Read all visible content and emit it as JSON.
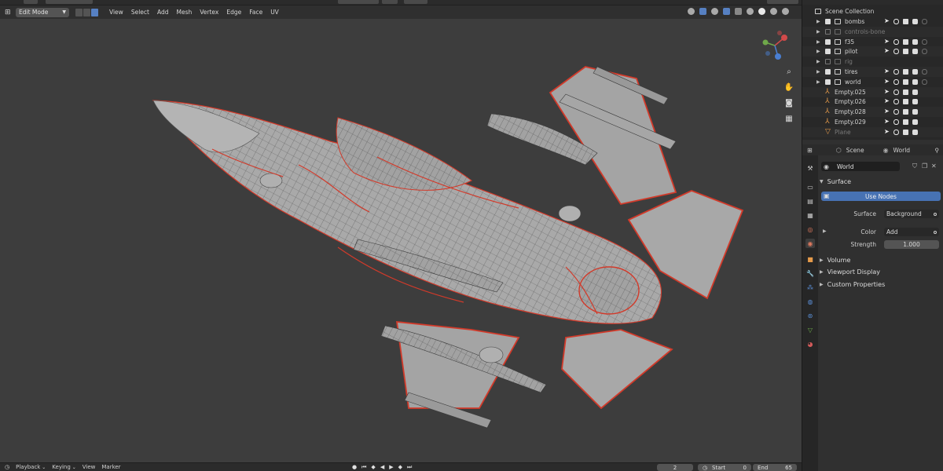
{
  "header": {
    "mode": "Edit Mode",
    "menu": [
      "View",
      "Select",
      "Add",
      "Mesh",
      "Vertex",
      "Edge",
      "Face",
      "UV"
    ]
  },
  "outliner": {
    "scene_collection": "Scene Collection",
    "rows": [
      {
        "label": "bombs",
        "type": "collection",
        "checked": true
      },
      {
        "label": "controls-bone",
        "type": "collection",
        "checked": false
      },
      {
        "label": "f35",
        "type": "collection",
        "checked": true
      },
      {
        "label": "pilot",
        "type": "collection",
        "checked": true
      },
      {
        "label": "rig",
        "type": "collection",
        "checked": false
      },
      {
        "label": "tires",
        "type": "collection",
        "checked": true
      },
      {
        "label": "world",
        "type": "collection",
        "checked": true
      },
      {
        "label": "Empty.025",
        "type": "empty"
      },
      {
        "label": "Empty.026",
        "type": "empty"
      },
      {
        "label": "Empty.028",
        "type": "empty"
      },
      {
        "label": "Empty.029",
        "type": "empty"
      },
      {
        "label": "Plane",
        "type": "mesh"
      }
    ]
  },
  "properties": {
    "breadcrumb_scene": "Scene",
    "breadcrumb_world": "World",
    "world_name": "World",
    "surface_title": "Surface",
    "use_nodes_label": "Use Nodes",
    "surface_label": "Surface",
    "surface_value": "Background",
    "color_label": "Color",
    "color_value": "Add",
    "strength_label": "Strength",
    "strength_value": "1.000",
    "volume_title": "Volume",
    "viewport_display_title": "Viewport Display",
    "custom_properties_title": "Custom Properties"
  },
  "timeline": {
    "playback": "Playback",
    "keying": "Keying",
    "view": "View",
    "marker": "Marker",
    "current_frame": "2",
    "start_label": "Start",
    "start_value": "0",
    "end_label": "End",
    "end_value": "65"
  },
  "colors": {
    "accent": "#4772b3",
    "seam_red": "#d23a2a",
    "object_orange": "#e59a4a"
  },
  "icons": {
    "gizmo": "axis-gizmo-icon",
    "zoom": "zoom-icon",
    "pan": "hand-icon",
    "camera": "camera-icon",
    "grid": "grid-icon"
  }
}
